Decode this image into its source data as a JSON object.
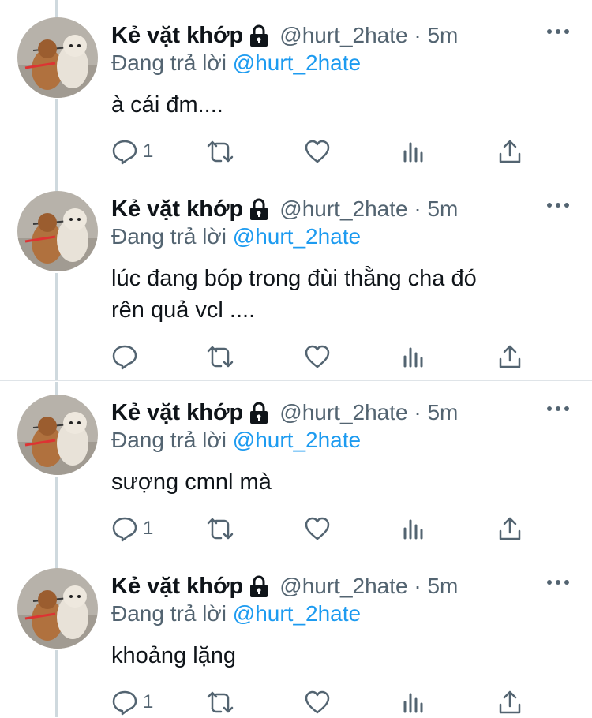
{
  "colors": {
    "link": "#1d9bf0",
    "secondary": "#536471",
    "text": "#0f1419",
    "thread_line": "#cfd9de"
  },
  "tweets": [
    {
      "name": "Kẻ vặt khớp",
      "handle": "@hurt_2hate · 5m",
      "reply_prefix": "Đang trả lời",
      "reply_mention": "@hurt_2hate",
      "lines": [
        "à cái đm...."
      ],
      "reply_count": "1",
      "protected_icon": "lock-icon"
    },
    {
      "name": "Kẻ vặt khớp",
      "handle": "@hurt_2hate · 5m",
      "reply_prefix": "Đang trả lời",
      "reply_mention": "@hurt_2hate",
      "lines": [
        "lúc đang bóp trong đùi thằng cha đó",
        "rên quả vcl ...."
      ],
      "reply_count": "",
      "protected_icon": "lock-icon"
    },
    {
      "name": "Kẻ vặt khớp",
      "handle": "@hurt_2hate · 5m",
      "reply_prefix": "Đang trả lời",
      "reply_mention": "@hurt_2hate",
      "lines": [
        "sượng cmnl mà"
      ],
      "reply_count": "1",
      "protected_icon": "lock-icon"
    },
    {
      "name": "Kẻ vặt khớp",
      "handle": "@hurt_2hate · 5m",
      "reply_prefix": "Đang trả lời",
      "reply_mention": "@hurt_2hate",
      "lines": [
        "khoảng lặng"
      ],
      "reply_count": "1",
      "protected_icon": "lock-icon"
    }
  ]
}
